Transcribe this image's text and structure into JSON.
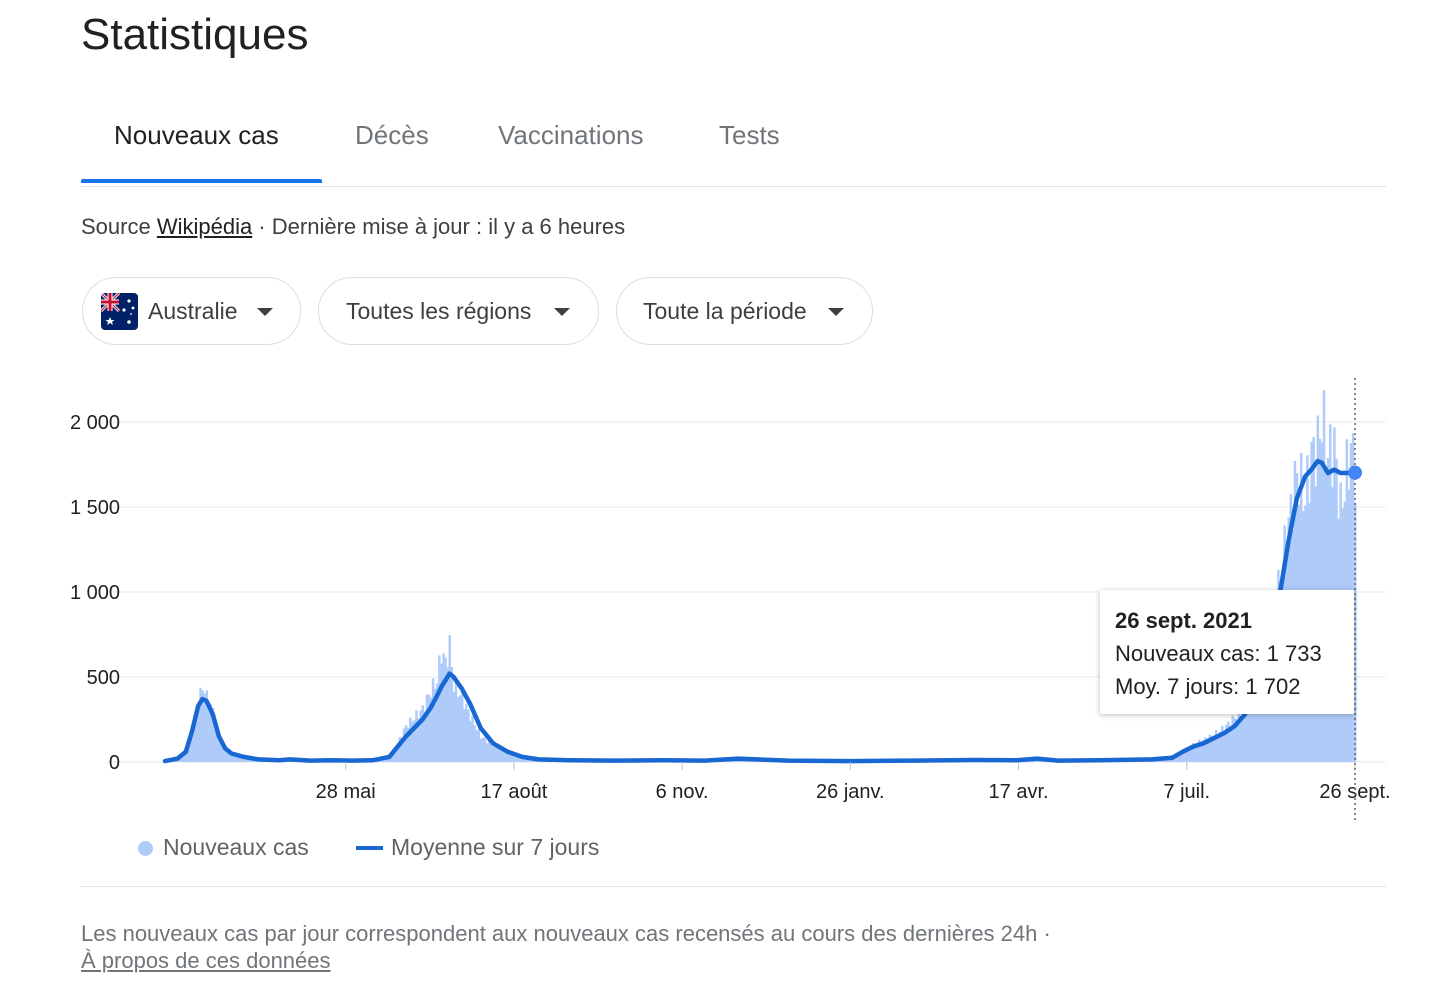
{
  "header": {
    "title": "Statistiques"
  },
  "tabs": [
    {
      "label": "Nouveaux cas",
      "active": true
    },
    {
      "label": "Décès",
      "active": false
    },
    {
      "label": "Vaccinations",
      "active": false
    },
    {
      "label": "Tests",
      "active": false
    }
  ],
  "source": {
    "prefix": "Source",
    "link": "Wikipédia",
    "updated": "· Dernière mise à jour : il y a 6 heures"
  },
  "filters": {
    "country": "Australie",
    "country_icon": "australia-flag-icon",
    "region": "Toutes les régions",
    "period": "Toute la période"
  },
  "colors": {
    "accent": "#1a73e8",
    "bars": "#aecbfa",
    "average_line": "#1967d2"
  },
  "tooltip": {
    "date": "26 sept. 2021",
    "line1": "Nouveaux cas: 1 733",
    "line2": "Moy. 7 jours: 1 702"
  },
  "legend": {
    "bars": "Nouveaux cas",
    "line": "Moyenne sur 7 jours"
  },
  "footer": {
    "note": "Les nouveaux cas par jour correspondent aux nouveaux cas recensés au cours des dernières 24h  ·",
    "about_link": "À propos de ces données"
  },
  "chart_data": {
    "type": "bar",
    "y_tick_labels": [
      "0",
      "500",
      "1 000",
      "1 500",
      "2 000"
    ],
    "y_ticks": [
      0,
      500,
      1000,
      1500,
      2000
    ],
    "ylim": [
      0,
      2200
    ],
    "x_tick_labels": [
      "28 mai",
      "17 août",
      "6 nov.",
      "26 janv.",
      "17 avr.",
      "7 juil.",
      "26 sept."
    ],
    "x_tick_days": [
      87,
      168,
      249,
      330,
      411,
      492,
      573
    ],
    "x_range_days": [
      0,
      573
    ],
    "grid": "horizontal",
    "legend_position": "bottom-left",
    "highlight_day": 573,
    "series": [
      {
        "name": "Nouveaux cas",
        "kind": "bar",
        "points": [
          [
            0,
            5
          ],
          [
            6,
            20
          ],
          [
            10,
            60
          ],
          [
            13,
            180
          ],
          [
            16,
            330
          ],
          [
            18,
            450
          ],
          [
            20,
            380
          ],
          [
            23,
            300
          ],
          [
            26,
            150
          ],
          [
            29,
            80
          ],
          [
            32,
            50
          ],
          [
            38,
            30
          ],
          [
            45,
            15
          ],
          [
            55,
            10
          ],
          [
            60,
            15
          ],
          [
            70,
            8
          ],
          [
            80,
            10
          ],
          [
            90,
            8
          ],
          [
            100,
            10
          ],
          [
            108,
            30
          ],
          [
            112,
            110
          ],
          [
            116,
            210
          ],
          [
            120,
            260
          ],
          [
            124,
            310
          ],
          [
            128,
            420
          ],
          [
            131,
            480
          ],
          [
            133,
            650
          ],
          [
            135,
            580
          ],
          [
            137,
            680
          ],
          [
            139,
            450
          ],
          [
            143,
            380
          ],
          [
            147,
            270
          ],
          [
            152,
            150
          ],
          [
            158,
            100
          ],
          [
            165,
            60
          ],
          [
            172,
            30
          ],
          [
            180,
            15
          ],
          [
            195,
            10
          ],
          [
            215,
            8
          ],
          [
            240,
            10
          ],
          [
            260,
            8
          ],
          [
            276,
            20
          ],
          [
            285,
            15
          ],
          [
            300,
            8
          ],
          [
            330,
            5
          ],
          [
            360,
            8
          ],
          [
            390,
            12
          ],
          [
            410,
            10
          ],
          [
            420,
            20
          ],
          [
            430,
            8
          ],
          [
            450,
            10
          ],
          [
            475,
            15
          ],
          [
            485,
            40
          ],
          [
            490,
            60
          ],
          [
            495,
            100
          ],
          [
            500,
            130
          ],
          [
            505,
            160
          ],
          [
            510,
            200
          ],
          [
            515,
            260
          ],
          [
            520,
            320
          ],
          [
            525,
            450
          ],
          [
            530,
            600
          ],
          [
            533,
            750
          ],
          [
            537,
            1100
          ],
          [
            541,
            1400
          ],
          [
            545,
            1700
          ],
          [
            549,
            1550
          ],
          [
            552,
            1800
          ],
          [
            555,
            1850
          ],
          [
            557,
            2030
          ],
          [
            560,
            1800
          ],
          [
            563,
            1850
          ],
          [
            566,
            1480
          ],
          [
            569,
            1700
          ],
          [
            571,
            1850
          ],
          [
            573,
            1733
          ]
        ]
      },
      {
        "name": "Moyenne sur 7 jours",
        "kind": "line",
        "points": [
          [
            0,
            5
          ],
          [
            6,
            20
          ],
          [
            10,
            60
          ],
          [
            13,
            180
          ],
          [
            16,
            330
          ],
          [
            18,
            370
          ],
          [
            20,
            360
          ],
          [
            23,
            280
          ],
          [
            26,
            150
          ],
          [
            29,
            80
          ],
          [
            32,
            50
          ],
          [
            38,
            30
          ],
          [
            45,
            15
          ],
          [
            55,
            10
          ],
          [
            60,
            15
          ],
          [
            70,
            8
          ],
          [
            80,
            10
          ],
          [
            90,
            8
          ],
          [
            100,
            10
          ],
          [
            108,
            30
          ],
          [
            112,
            90
          ],
          [
            116,
            150
          ],
          [
            120,
            200
          ],
          [
            124,
            250
          ],
          [
            128,
            320
          ],
          [
            131,
            390
          ],
          [
            133,
            440
          ],
          [
            135,
            480
          ],
          [
            137,
            520
          ],
          [
            139,
            500
          ],
          [
            143,
            430
          ],
          [
            147,
            340
          ],
          [
            152,
            200
          ],
          [
            158,
            110
          ],
          [
            165,
            60
          ],
          [
            172,
            30
          ],
          [
            180,
            15
          ],
          [
            195,
            10
          ],
          [
            215,
            8
          ],
          [
            240,
            10
          ],
          [
            260,
            8
          ],
          [
            276,
            20
          ],
          [
            285,
            15
          ],
          [
            300,
            8
          ],
          [
            330,
            5
          ],
          [
            360,
            8
          ],
          [
            390,
            12
          ],
          [
            410,
            10
          ],
          [
            420,
            20
          ],
          [
            430,
            8
          ],
          [
            450,
            10
          ],
          [
            475,
            15
          ],
          [
            485,
            25
          ],
          [
            490,
            60
          ],
          [
            495,
            90
          ],
          [
            500,
            110
          ],
          [
            505,
            140
          ],
          [
            510,
            170
          ],
          [
            515,
            210
          ],
          [
            520,
            280
          ],
          [
            525,
            400
          ],
          [
            530,
            550
          ],
          [
            533,
            700
          ],
          [
            537,
            1000
          ],
          [
            541,
            1300
          ],
          [
            545,
            1550
          ],
          [
            549,
            1680
          ],
          [
            552,
            1720
          ],
          [
            555,
            1770
          ],
          [
            557,
            1760
          ],
          [
            560,
            1700
          ],
          [
            563,
            1720
          ],
          [
            566,
            1700
          ],
          [
            569,
            1700
          ],
          [
            571,
            1700
          ],
          [
            573,
            1702
          ]
        ]
      }
    ]
  }
}
